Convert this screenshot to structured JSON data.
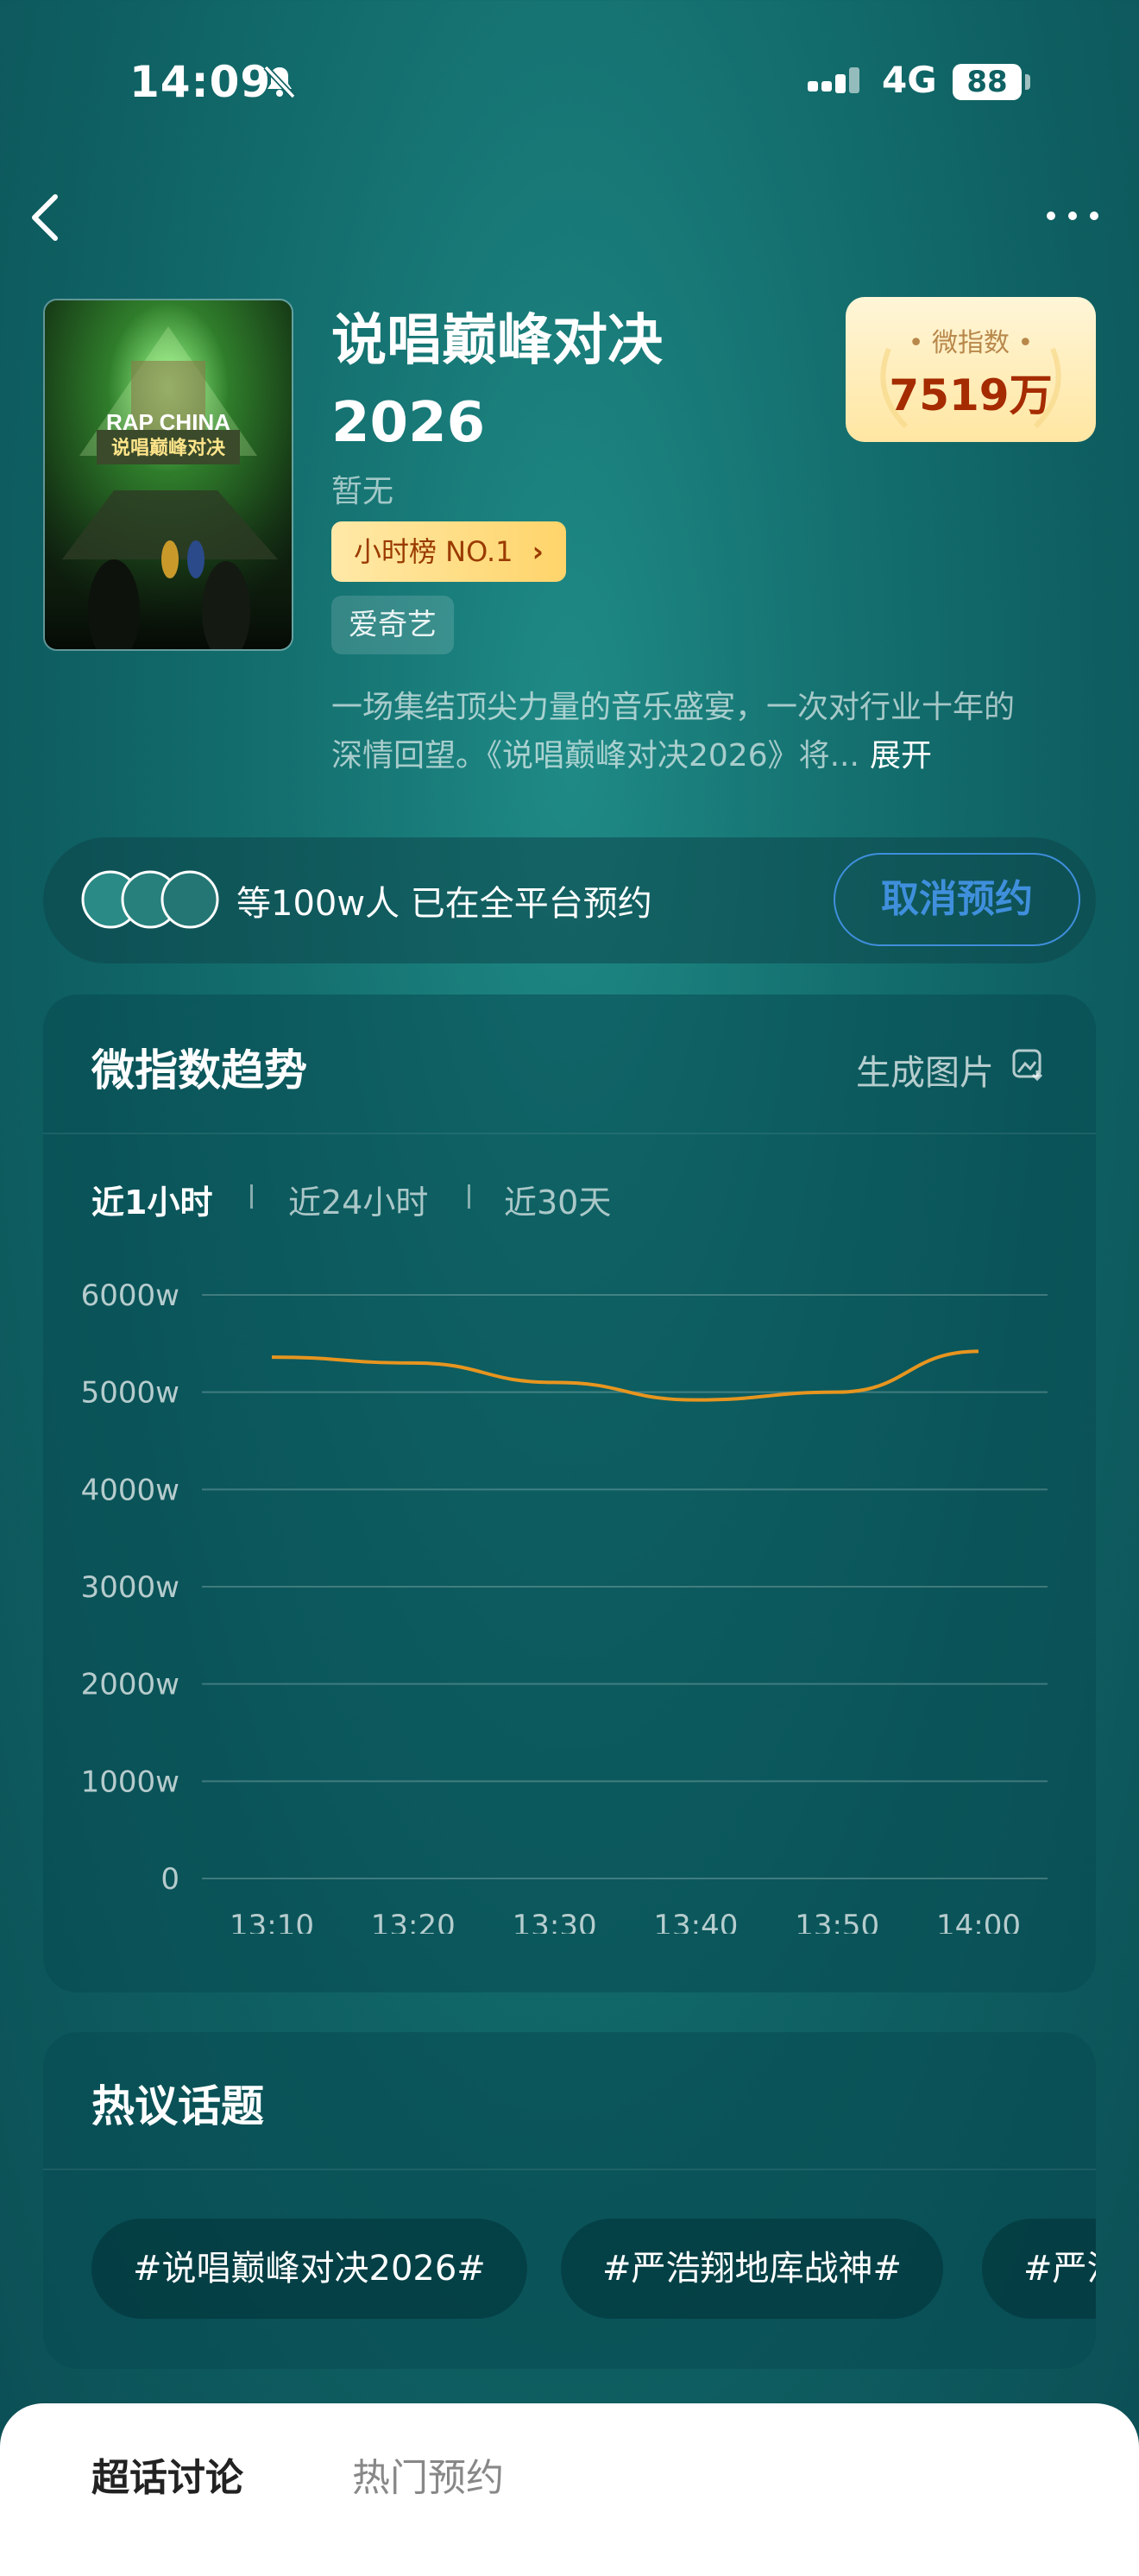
{
  "status_bar": {
    "time": "14:09",
    "network": "4G",
    "battery": "88"
  },
  "show": {
    "title_line1": "说唱巅峰对决",
    "title_line2": "2026",
    "subtitle": "暂无",
    "rank_label": "小时榜 NO.1",
    "platform": "爱奇艺",
    "index_label": "微指数",
    "index_value": "7519万",
    "description_line1": "一场集结顶尖力量的音乐盛宴，一次对行业十年的",
    "description_line2": "深情回望。《说唱巅峰对决2026》将...",
    "expand": "展开",
    "poster_text": "RAP CHINA",
    "poster_sub": "说唱巅峰对决"
  },
  "reserve": {
    "text": "等100w人 已在全平台预约",
    "cancel_label": "取消预约"
  },
  "trend": {
    "title": "微指数趋势",
    "generate_image": "生成图片",
    "tabs": [
      "近1小时",
      "近24小时",
      "近30天"
    ],
    "active_tab": 0
  },
  "chart_data": {
    "type": "line",
    "x": [
      "13:10",
      "13:20",
      "13:30",
      "13:40",
      "13:50",
      "14:00"
    ],
    "series": [
      {
        "values": [
          5360,
          5300,
          5100,
          4920,
          5000,
          5420
        ],
        "color": "#e7951f"
      }
    ],
    "y_ticks": [
      "0",
      "1000w",
      "2000w",
      "3000w",
      "4000w",
      "5000w",
      "6000w"
    ],
    "ylim": [
      0,
      6000
    ],
    "grid": true
  },
  "topics": {
    "title": "热议话题",
    "chips": [
      "#说唱巅峰对决2026#",
      "#严浩翔地库战神#",
      "#严浩"
    ]
  },
  "bottom_sheet": {
    "tabs": [
      "超话讨论",
      "热门预约"
    ]
  }
}
